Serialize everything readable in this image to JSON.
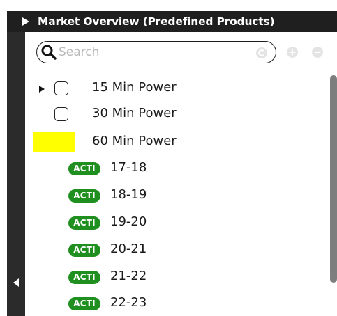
{
  "panel": {
    "title": "Market Overview (Predefined Products)"
  },
  "search": {
    "placeholder": "Search",
    "value": ""
  },
  "tree": {
    "products": [
      {
        "label": "15 Min Power",
        "expandable": true,
        "checked": false
      },
      {
        "label": "30 Min Power",
        "expandable": false,
        "checked": false
      },
      {
        "label": "60 Min Power",
        "expandable": false,
        "highlighted": true
      }
    ],
    "contracts": [
      {
        "badge": "ACTI",
        "label": "17-18"
      },
      {
        "badge": "ACTI",
        "label": "18-19"
      },
      {
        "badge": "ACTI",
        "label": "19-20"
      },
      {
        "badge": "ACTI",
        "label": "20-21"
      },
      {
        "badge": "ACTI",
        "label": "21-22"
      },
      {
        "badge": "ACTI",
        "label": "22-23"
      }
    ]
  },
  "icons": {
    "title_toggle": "triangle-right-icon",
    "collapse": "triangle-left-icon",
    "search": "search-icon",
    "clear": "clear-icon",
    "add": "add-icon",
    "remove": "remove-icon",
    "expander": "triangle-right-icon"
  },
  "colors": {
    "title_bar": "#1f1f1f",
    "side_strip": "#2b2b2b",
    "highlight": "#ffff00",
    "badge": "#1f8f1f",
    "scroll_thumb": "#7e7e7e"
  }
}
